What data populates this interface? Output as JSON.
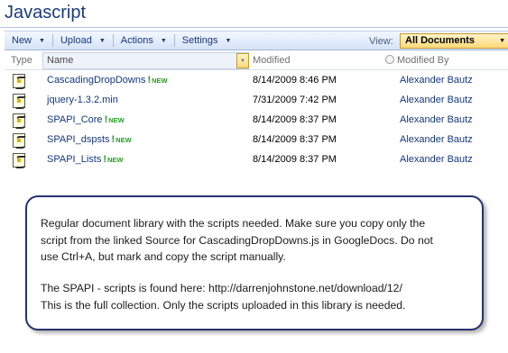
{
  "page": {
    "title": "Javascript"
  },
  "toolbar": {
    "items": [
      {
        "label": "New"
      },
      {
        "label": "Upload"
      },
      {
        "label": "Actions"
      },
      {
        "label": "Settings"
      }
    ],
    "view_label": "View:",
    "view_value": "All Documents"
  },
  "list": {
    "columns": {
      "type": "Type",
      "name": "Name",
      "modified": "Modified",
      "modified_by": "Modified By"
    },
    "rows": [
      {
        "name": "CascadingDropDowns",
        "is_new": true,
        "new_label": "NEW",
        "modified": "8/14/2009 8:46 PM",
        "modified_by": "Alexander Bautz"
      },
      {
        "name": "jquery-1.3.2.min",
        "is_new": false,
        "new_label": "",
        "modified": "7/31/2009 7:42 PM",
        "modified_by": "Alexander Bautz"
      },
      {
        "name": "SPAPI_Core",
        "is_new": true,
        "new_label": "NEW",
        "modified": "8/14/2009 8:37 PM",
        "modified_by": "Alexander Bautz"
      },
      {
        "name": "SPAPI_dspsts",
        "is_new": true,
        "new_label": "NEW",
        "modified": "8/14/2009 8:37 PM",
        "modified_by": "Alexander Bautz"
      },
      {
        "name": "SPAPI_Lists",
        "is_new": true,
        "new_label": "NEW",
        "modified": "8/14/2009 8:37 PM",
        "modified_by": "Alexander Bautz"
      }
    ]
  },
  "callout": {
    "paragraph1": "Regular document library with the scripts needed. Make sure you copy only the\nscript from the linked Source for CascadingDropDowns.js in GoogleDocs. Do not\nuse Ctrl+A, but mark and copy the script manually.",
    "paragraph2": "The SPAPI - scripts is found here: http://darrenjohnstone.net/download/12/\nThis is the full collection. Only the scripts uploaded in this library is needed."
  },
  "colors": {
    "link": "#14377f",
    "new_badge": "#22a022",
    "callout_border": "#27336e"
  }
}
